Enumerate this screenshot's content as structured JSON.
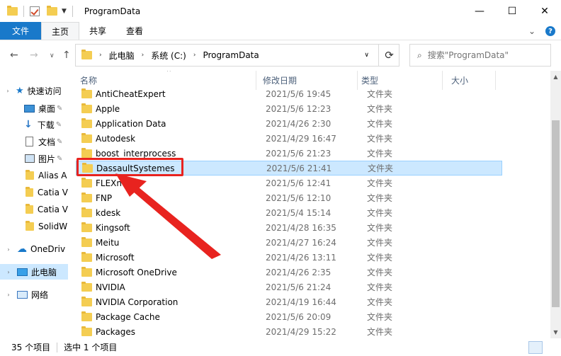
{
  "window": {
    "title": "ProgramData"
  },
  "ribbon": {
    "tabs": [
      "文件",
      "主页",
      "共享",
      "查看"
    ],
    "help_glyph": "?"
  },
  "address": {
    "path": [
      "此电脑",
      "系统 (C:)",
      "ProgramData"
    ],
    "search_placeholder": "搜索\"ProgramData\""
  },
  "nav": {
    "items": [
      {
        "label": "快速访问",
        "icon": "star-icon"
      },
      {
        "label": "桌面",
        "icon": "desktop-icon",
        "pinned": true
      },
      {
        "label": "下载",
        "icon": "download-icon",
        "pinned": true
      },
      {
        "label": "文档",
        "icon": "document-icon",
        "pinned": true
      },
      {
        "label": "图片",
        "icon": "picture-icon",
        "pinned": true
      },
      {
        "label": "Alias A",
        "icon": "folder-icon"
      },
      {
        "label": "Catia V",
        "icon": "folder-icon"
      },
      {
        "label": "Catia V",
        "icon": "folder-icon"
      },
      {
        "label": "SolidW",
        "icon": "folder-icon"
      },
      {
        "label": "OneDriv",
        "icon": "cloud-icon"
      },
      {
        "label": "此电脑",
        "icon": "pc-icon",
        "selected": true
      },
      {
        "label": "网络",
        "icon": "network-icon"
      }
    ]
  },
  "columns": [
    "名称",
    "修改日期",
    "类型",
    "大小"
  ],
  "files": [
    {
      "name": "AntiCheatExpert",
      "date": "2021/5/6 19:45",
      "type": "文件夹"
    },
    {
      "name": "Apple",
      "date": "2021/5/6 12:23",
      "type": "文件夹"
    },
    {
      "name": "Application Data",
      "date": "2021/4/26 2:30",
      "type": "文件夹"
    },
    {
      "name": "Autodesk",
      "date": "2021/4/29 16:47",
      "type": "文件夹"
    },
    {
      "name": "boost_interprocess",
      "date": "2021/5/6 21:23",
      "type": "文件夹"
    },
    {
      "name": "DassaultSystemes",
      "date": "2021/5/6 21:41",
      "type": "文件夹",
      "selected": true
    },
    {
      "name": "FLEXnet",
      "date": "2021/5/6 12:41",
      "type": "文件夹"
    },
    {
      "name": "FNP",
      "date": "2021/5/6 12:10",
      "type": "文件夹"
    },
    {
      "name": "kdesk",
      "date": "2021/5/4 15:14",
      "type": "文件夹"
    },
    {
      "name": "Kingsoft",
      "date": "2021/4/28 16:35",
      "type": "文件夹"
    },
    {
      "name": "Meitu",
      "date": "2021/4/27 16:24",
      "type": "文件夹"
    },
    {
      "name": "Microsoft",
      "date": "2021/4/26 13:11",
      "type": "文件夹"
    },
    {
      "name": "Microsoft OneDrive",
      "date": "2021/4/26 2:35",
      "type": "文件夹"
    },
    {
      "name": "NVIDIA",
      "date": "2021/5/6 21:24",
      "type": "文件夹"
    },
    {
      "name": "NVIDIA Corporation",
      "date": "2021/4/19 16:44",
      "type": "文件夹"
    },
    {
      "name": "Package Cache",
      "date": "2021/5/6 20:09",
      "type": "文件夹"
    },
    {
      "name": "Packages",
      "date": "2021/4/29 15:22",
      "type": "文件夹"
    }
  ],
  "status": {
    "item_count": "35 个项目",
    "selected": "选中 1 个项目"
  },
  "colors": {
    "accent": "#1979ca",
    "selection": "#cce8ff",
    "annotation": "#e8231f"
  }
}
